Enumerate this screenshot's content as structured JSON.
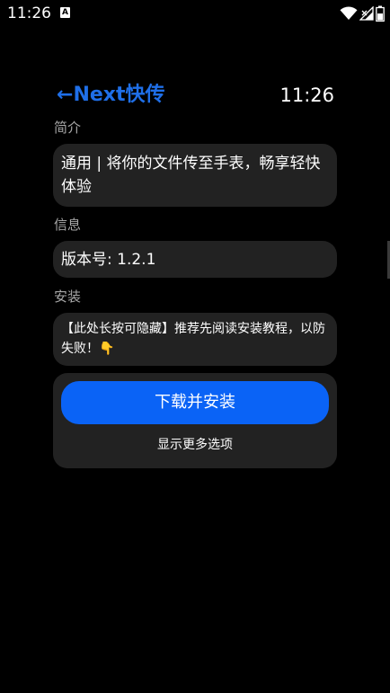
{
  "status_bar": {
    "time": "11:26",
    "notification_badge": "A",
    "icons": [
      "wifi-icon",
      "signal-icon",
      "battery-icon"
    ]
  },
  "header": {
    "back_arrow": "←",
    "title": "Next快传",
    "clock": "11:26"
  },
  "sections": {
    "intro_label": "简介",
    "intro_text": "通用 | 将你的文件传至手表，畅享轻快体验",
    "info_label": "信息",
    "version_text": "版本号: 1.2.1",
    "install_label": "安装",
    "install_note": "【此处长按可隐藏】推荐先阅读安装教程，以防失败！👇"
  },
  "actions": {
    "install_button": "下载并安装",
    "more_options": "显示更多选项"
  },
  "colors": {
    "background": "#000000",
    "card": "#222222",
    "accent": "#1f6fe8",
    "button": "#0a63f6",
    "label": "#a8a8a8"
  }
}
